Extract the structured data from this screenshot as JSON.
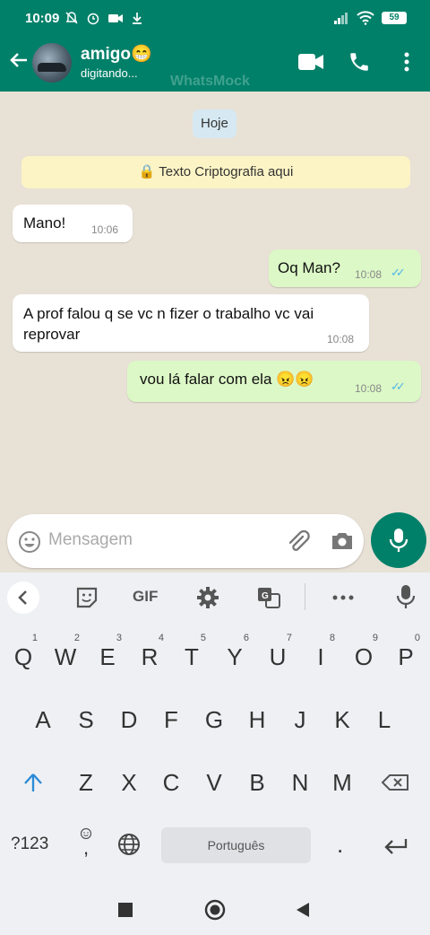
{
  "status_bar": {
    "time": "10:09",
    "battery": "59"
  },
  "header": {
    "contact_name": "amigo😁",
    "contact_status": "digitando...",
    "watermark": "WhatsMock"
  },
  "chat": {
    "date_chip": "Hoje",
    "encryption_notice": "🔒 Texto Criptografia aqui",
    "messages": [
      {
        "text": "Mano!",
        "time": "10:06",
        "direction": "in"
      },
      {
        "text": "Oq Man?",
        "time": "10:08",
        "direction": "out"
      },
      {
        "text": "A prof falou q se vc n fizer o trabalho vc vai reprovar",
        "time": "10:08",
        "direction": "in"
      },
      {
        "text": "vou lá falar com ela 😠😠",
        "time": "10:08",
        "direction": "out"
      }
    ]
  },
  "composer": {
    "placeholder": "Mensagem"
  },
  "keyboard": {
    "toolbar": {
      "gif_label": "GIF"
    },
    "row1": [
      "Q",
      "W",
      "E",
      "R",
      "T",
      "Y",
      "U",
      "I",
      "O",
      "P"
    ],
    "row1_numbers": [
      "1",
      "2",
      "3",
      "4",
      "5",
      "6",
      "7",
      "8",
      "9",
      "0"
    ],
    "row2": [
      "A",
      "S",
      "D",
      "F",
      "G",
      "H",
      "J",
      "K",
      "L"
    ],
    "row3": [
      "Z",
      "X",
      "C",
      "V",
      "B",
      "N",
      "M"
    ],
    "symbols_label": "?123",
    "comma_label": ",",
    "space_label": "Português",
    "period_label": "."
  },
  "colors": {
    "header": "#008069",
    "outgoing_bubble": "#dcf8c6",
    "incoming_bubble": "#ffffff",
    "read_ticks": "#4fb6ec"
  }
}
